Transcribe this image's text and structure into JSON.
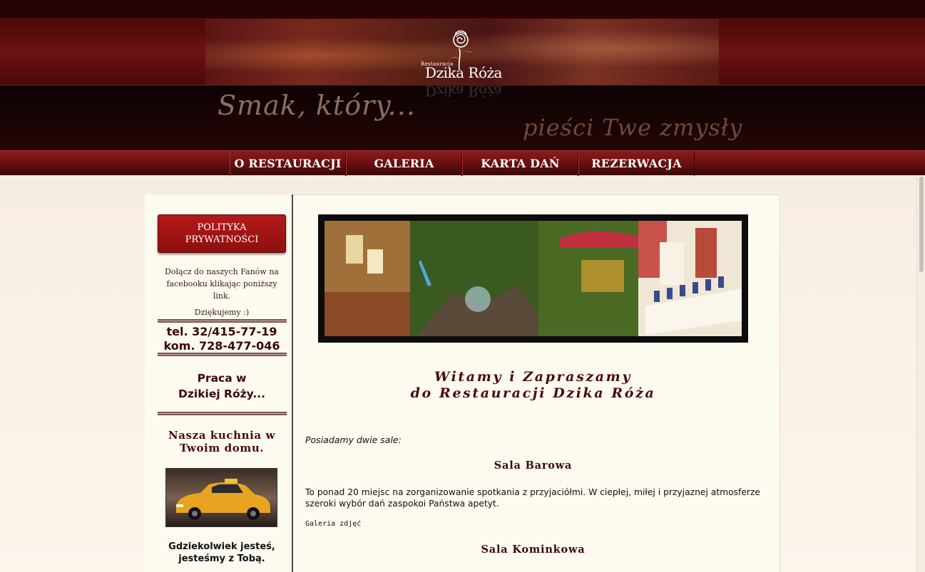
{
  "header": {
    "logo_small": "Restauracja",
    "logo_name": "Dzika Róża",
    "slogan_left": "Smak, który...",
    "slogan_right": "pieści Twe zmysły"
  },
  "nav": {
    "items": [
      "O RESTAURACJI",
      "GALERIA",
      "KARTA DAŃ",
      "REZERWACJA"
    ]
  },
  "sidebar": {
    "privacy_line1": "POLITYKA",
    "privacy_line2": "PRYWATNOŚCI",
    "fb_line1": "Dołącz do naszych Fanów na",
    "fb_line2": "facebooku klikając poniższy link.",
    "thanks": "Dziękujemy :)",
    "phone": "tel. 32/415-77-19",
    "mobile": "kom. 728-477-046",
    "job_line1": "Praca w",
    "job_line2": "Dzikiej Róży...",
    "kitchen_line1": "Nasza kuchnia w",
    "kitchen_line2": "Twoim domu.",
    "taxi_line1": "Gdziekolwiek jesteś,",
    "taxi_line2": "jesteśmy z Tobą."
  },
  "main": {
    "welcome_line1": "Witamy i Zapraszamy",
    "welcome_line2": "do Restauracji Dzika Róża",
    "intro": "Posiadamy dwie sale:",
    "room1_title": "Sala Barowa",
    "room1_desc": "To ponad 20 miejsc na zorganizowanie spotkania z przyjaciółmi. W ciepłej, miłej i przyjaznej atmosferze szeroki wybór dań zaspokoi Państwa apetyt.",
    "gallery_link": "Galeria zdjęć",
    "room2_title": "Sala Kominkowa"
  },
  "colors": {
    "brand_dark_red": "#4a0a0a",
    "nav_red": "#6a1010",
    "button_red": "#a81616",
    "page_bg": "#fdfaf0"
  }
}
